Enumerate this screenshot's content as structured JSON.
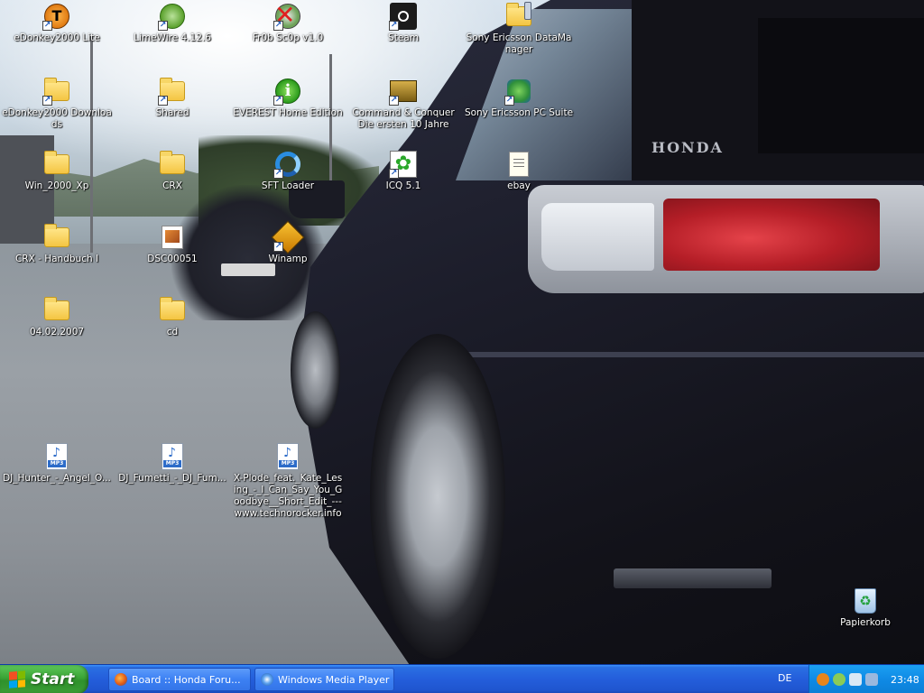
{
  "desktop": {
    "icons": [
      {
        "label": "eDonkey2000 Lite",
        "icon": "edonkey-icon"
      },
      {
        "label": "LimeWire 4.12.6",
        "icon": "limewire-icon"
      },
      {
        "label": "Fr0b Sc0p v1.0",
        "icon": "frob-icon"
      },
      {
        "label": "Steam",
        "icon": "steam-icon"
      },
      {
        "label": "Sony Ericsson DataManager",
        "icon": "sony-ericsson-datamanager-icon"
      },
      {
        "label": "eDonkey2000 Downloads",
        "icon": "folder-icon"
      },
      {
        "label": "Shared",
        "icon": "folder-icon"
      },
      {
        "label": "EVEREST Home Edition",
        "icon": "everest-icon"
      },
      {
        "label": "Command & Conquer Die ersten 10 Jahre",
        "icon": "command-conquer-icon"
      },
      {
        "label": "Sony Ericsson PC Suite",
        "icon": "sony-ericsson-pc-suite-icon"
      },
      {
        "label": "Win_2000_Xp",
        "icon": "folder-icon"
      },
      {
        "label": "CRX",
        "icon": "folder-icon"
      },
      {
        "label": "SFT Loader",
        "icon": "sft-loader-icon"
      },
      {
        "label": "ICQ 5.1",
        "icon": "icq-icon"
      },
      {
        "label": "ebay",
        "icon": "text-document-icon"
      },
      {
        "label": "CRX - Handbuch I",
        "icon": "folder-icon"
      },
      {
        "label": "DSC00051",
        "icon": "image-file-icon"
      },
      {
        "label": "Winamp",
        "icon": "winamp-icon"
      },
      {
        "label": "04.02.2007",
        "icon": "folder-icon"
      },
      {
        "label": "cd",
        "icon": "folder-icon"
      },
      {
        "label": "DJ_Hunter_-_Angel_O...",
        "icon": "mp3-file-icon"
      },
      {
        "label": "DJ_Fumetti_-_DJ_Fum...",
        "icon": "mp3-file-icon"
      },
      {
        "label": "X-Plode_feat._Kate_Lesing_-_I_Can_Say_You_Goodbye__Short_Edit_---www.technorocker.info",
        "icon": "mp3-file-icon"
      },
      {
        "label": "Papierkorb",
        "icon": "recycle-bin-icon"
      }
    ],
    "wallpaper": {
      "badge_text": "HONDA"
    }
  },
  "taskbar": {
    "start_label": "Start",
    "buttons": [
      {
        "label": "Board :: Honda Foru...",
        "icon": "firefox-icon"
      },
      {
        "label": "Windows Media Player",
        "icon": "windows-media-player-icon"
      }
    ],
    "language": "DE",
    "clock": "23:48"
  },
  "colors": {
    "taskbar_blue": "#245edb",
    "start_green": "#3aa335",
    "tray_blue": "#0f8ae5"
  }
}
